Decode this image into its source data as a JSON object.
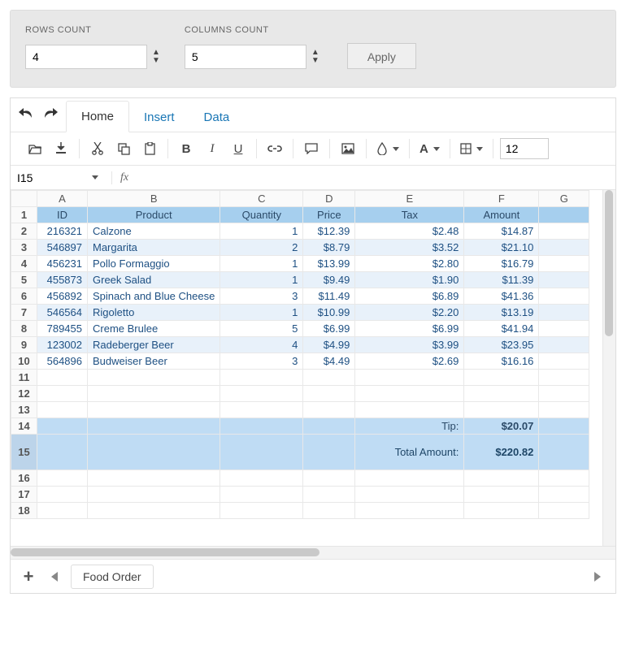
{
  "controls": {
    "rows_label": "ROWS COUNT",
    "cols_label": "COLUMNS COUNT",
    "rows_value": "4",
    "cols_value": "5",
    "apply_label": "Apply"
  },
  "ribbon": {
    "home": "Home",
    "insert": "Insert",
    "data": "Data",
    "font_size": "12"
  },
  "formula_bar": {
    "cell_ref": "I15",
    "fx_label": "fx",
    "formula": ""
  },
  "columns": [
    "A",
    "B",
    "C",
    "D",
    "E",
    "F",
    "G"
  ],
  "headers": {
    "id": "ID",
    "product": "Product",
    "quantity": "Quantity",
    "price": "Price",
    "tax": "Tax",
    "amount": "Amount"
  },
  "rows": [
    {
      "id": "216321",
      "product": "Calzone",
      "quantity": "1",
      "price": "$12.39",
      "tax": "$2.48",
      "amount": "$14.87"
    },
    {
      "id": "546897",
      "product": "Margarita",
      "quantity": "2",
      "price": "$8.79",
      "tax": "$3.52",
      "amount": "$21.10"
    },
    {
      "id": "456231",
      "product": "Pollo Formaggio",
      "quantity": "1",
      "price": "$13.99",
      "tax": "$2.80",
      "amount": "$16.79"
    },
    {
      "id": "455873",
      "product": "Greek Salad",
      "quantity": "1",
      "price": "$9.49",
      "tax": "$1.90",
      "amount": "$11.39"
    },
    {
      "id": "456892",
      "product": "Spinach and Blue Cheese",
      "quantity": "3",
      "price": "$11.49",
      "tax": "$6.89",
      "amount": "$41.36"
    },
    {
      "id": "546564",
      "product": "Rigoletto",
      "quantity": "1",
      "price": "$10.99",
      "tax": "$2.20",
      "amount": "$13.19"
    },
    {
      "id": "789455",
      "product": "Creme Brulee",
      "quantity": "5",
      "price": "$6.99",
      "tax": "$6.99",
      "amount": "$41.94"
    },
    {
      "id": "123002",
      "product": "Radeberger Beer",
      "quantity": "4",
      "price": "$4.99",
      "tax": "$3.99",
      "amount": "$23.95"
    },
    {
      "id": "564896",
      "product": "Budweiser Beer",
      "quantity": "3",
      "price": "$4.49",
      "tax": "$2.69",
      "amount": "$16.16"
    }
  ],
  "summary": {
    "tip_label": "Tip:",
    "tip_value": "$20.07",
    "total_label": "Total Amount:",
    "total_value": "$220.82"
  },
  "sheet_tabs": {
    "name": "Food Order"
  }
}
